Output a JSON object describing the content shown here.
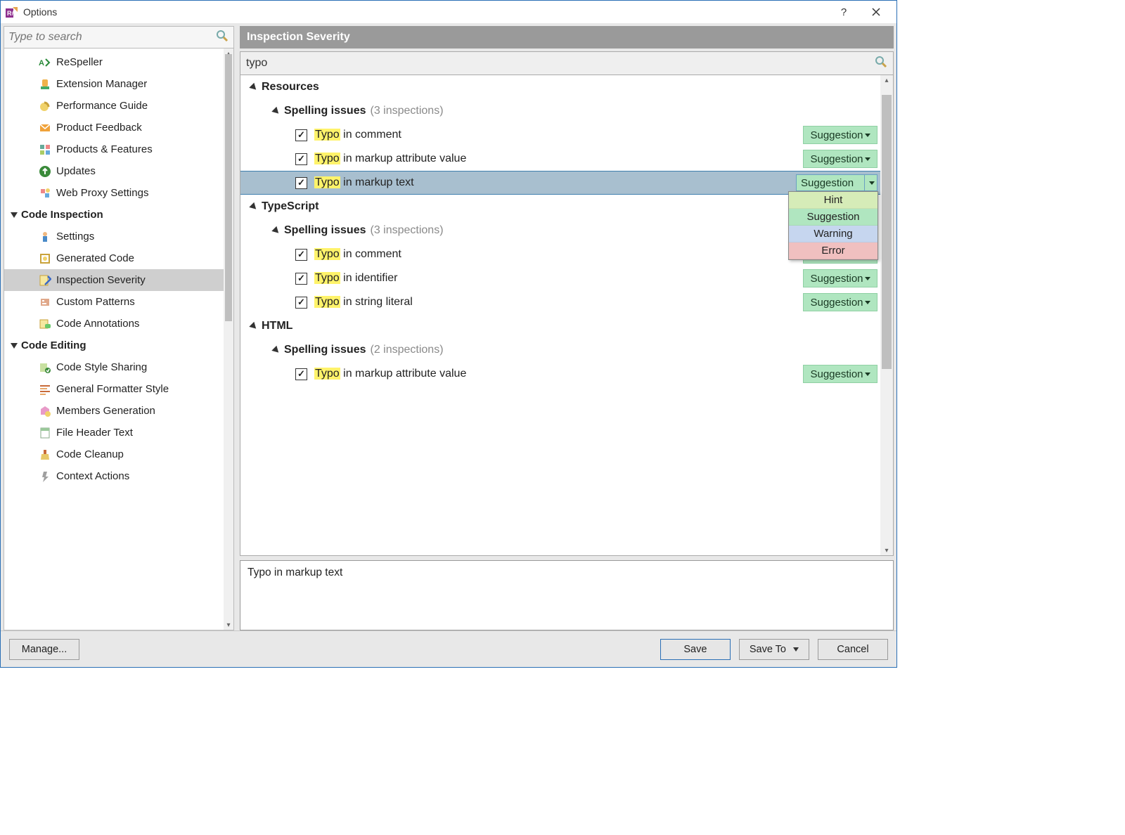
{
  "titlebar": {
    "title": "Options"
  },
  "sidebar": {
    "search_placeholder": "Type to search",
    "items_top": [
      "ReSpeller",
      "Extension Manager",
      "Performance Guide",
      "Product Feedback",
      "Products & Features",
      "Updates",
      "Web Proxy Settings"
    ],
    "header_codeinspection": "Code Inspection",
    "items_codeinspection": [
      "Settings",
      "Generated Code",
      "Inspection Severity",
      "Custom Patterns",
      "Code Annotations"
    ],
    "header_codeediting": "Code Editing",
    "items_codeediting": [
      "Code Style Sharing",
      "General Formatter Style",
      "Members Generation",
      "File Header Text",
      "Code Cleanup",
      "Context Actions"
    ]
  },
  "right": {
    "header": "Inspection Severity",
    "filter_value": "typo",
    "desc": "Typo in markup text",
    "sev_label": "Suggestion",
    "popup": {
      "hint": "Hint",
      "sugg": "Suggestion",
      "warn": "Warning",
      "error": "Error"
    },
    "groups": [
      {
        "category": "Resources",
        "sub_label": "Spelling issues",
        "sub_count": "(3 inspections)",
        "rows": [
          {
            "hl": "Typo",
            "rest": " in comment",
            "selected": false
          },
          {
            "hl": "Typo",
            "rest": " in markup attribute value",
            "selected": false
          },
          {
            "hl": "Typo",
            "rest": " in markup text",
            "selected": true
          }
        ]
      },
      {
        "category": "TypeScript",
        "sub_label": "Spelling issues",
        "sub_count": "(3 inspections)",
        "rows": [
          {
            "hl": "Typo",
            "rest": " in comment",
            "selected": false
          },
          {
            "hl": "Typo",
            "rest": " in identifier",
            "selected": false
          },
          {
            "hl": "Typo",
            "rest": " in string literal",
            "selected": false
          }
        ]
      },
      {
        "category": "HTML",
        "sub_label": "Spelling issues",
        "sub_count": "(2 inspections)",
        "rows": [
          {
            "hl": "Typo",
            "rest": " in markup attribute value",
            "selected": false
          }
        ]
      }
    ]
  },
  "bottom": {
    "manage": "Manage...",
    "save": "Save",
    "saveto": "Save To",
    "cancel": "Cancel"
  }
}
